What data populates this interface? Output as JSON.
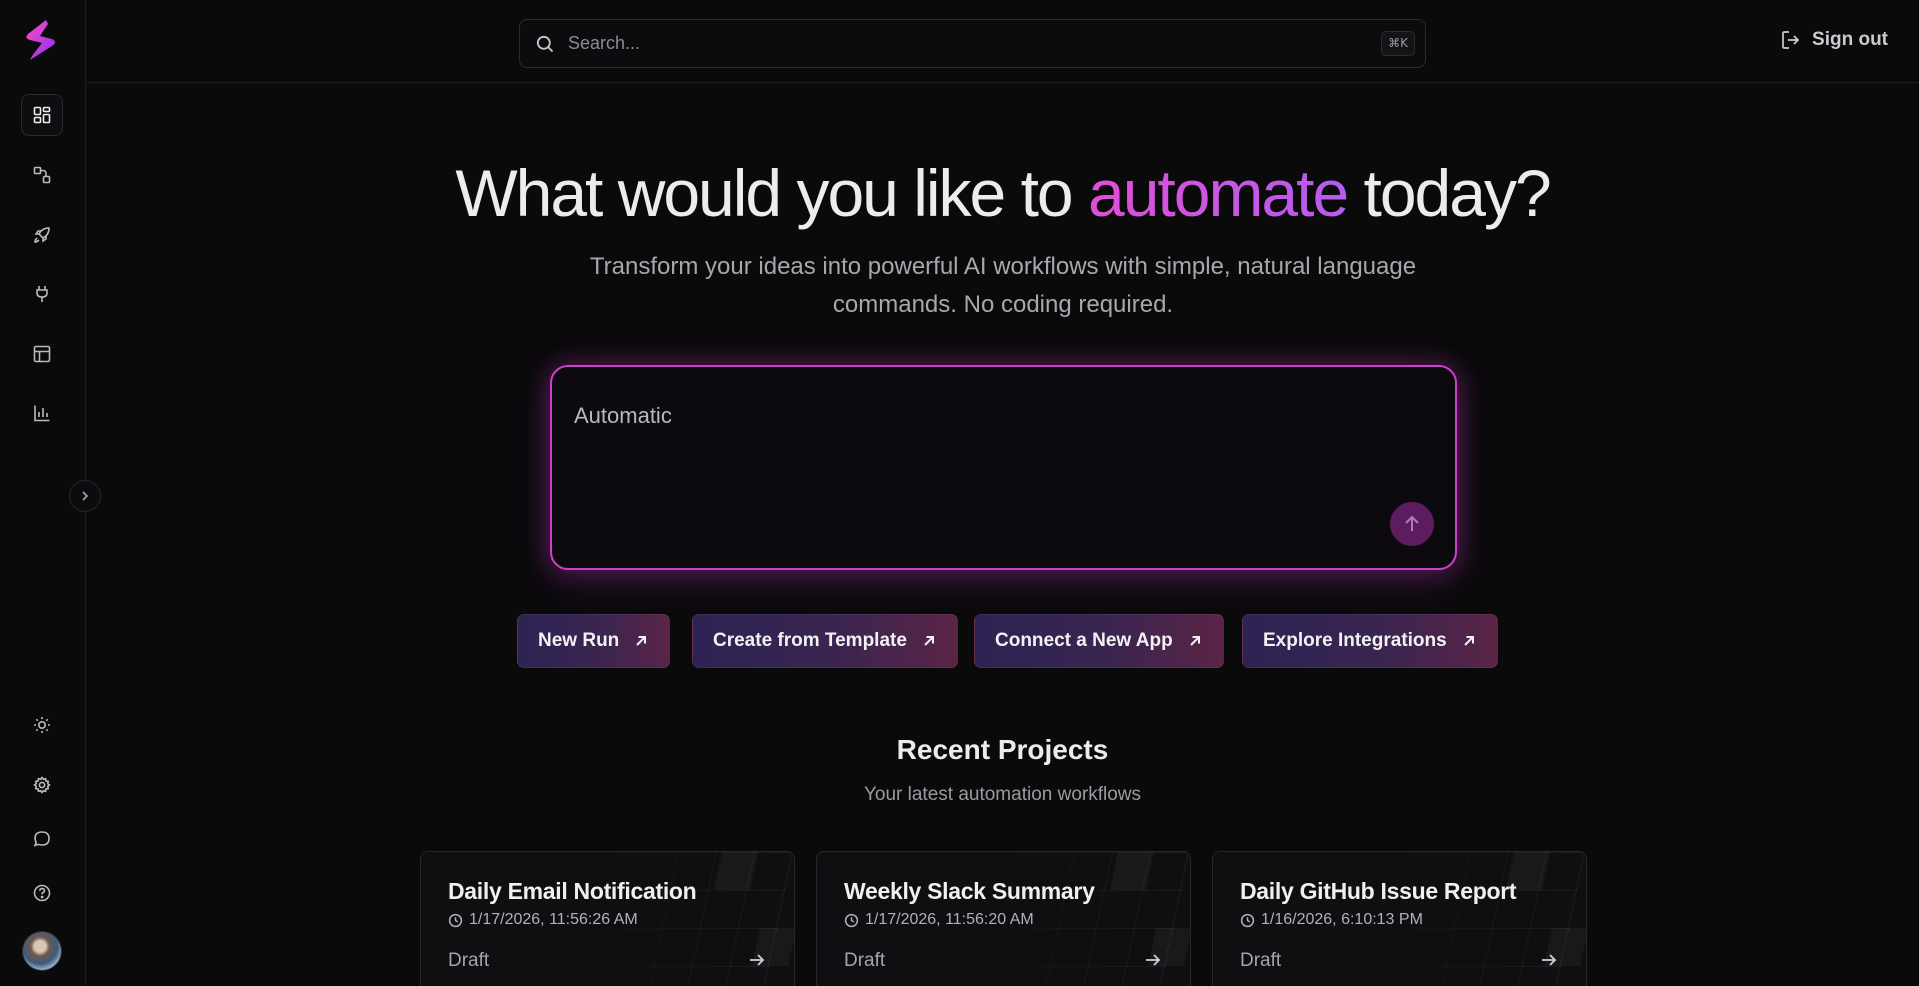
{
  "search": {
    "placeholder": "Search...",
    "shortcut": "⌘K"
  },
  "header": {
    "signout_label": "Sign out"
  },
  "hero": {
    "title_before": "What would you like to ",
    "title_accent": "automate",
    "title_after": " today?",
    "subtitle": "Transform your ideas into powerful AI workflows with simple, natural language commands. No coding required."
  },
  "prompt": {
    "value": "Automatic"
  },
  "actions": [
    {
      "label": "New Run"
    },
    {
      "label": "Create from Template"
    },
    {
      "label": "Connect a New App"
    },
    {
      "label": "Explore Integrations"
    }
  ],
  "recent": {
    "title": "Recent Projects",
    "subtitle": "Your latest automation workflows",
    "projects": [
      {
        "title": "Daily Email Notification",
        "date": "1/17/2026, 11:56:26 AM",
        "status": "Draft"
      },
      {
        "title": "Weekly Slack Summary",
        "date": "1/17/2026, 11:56:20 AM",
        "status": "Draft"
      },
      {
        "title": "Daily GitHub Issue Report",
        "date": "1/16/2026, 6:10:13 PM",
        "status": "Draft"
      }
    ]
  },
  "sidebar": {
    "nav": [
      {
        "icon": "dashboard-icon",
        "active": true
      },
      {
        "icon": "workflow-icon",
        "active": false
      },
      {
        "icon": "rocket-icon",
        "active": false
      },
      {
        "icon": "plug-icon",
        "active": false
      },
      {
        "icon": "template-layout-icon",
        "active": false
      },
      {
        "icon": "bar-chart-icon",
        "active": false
      }
    ],
    "bottom": [
      {
        "icon": "sun-icon"
      },
      {
        "icon": "gear-icon"
      },
      {
        "icon": "chat-bubble-icon"
      },
      {
        "icon": "help-circle-icon"
      }
    ]
  },
  "colors": {
    "accent": "#cf3fcc",
    "accent_gradient_start": "#e04fd6",
    "accent_gradient_end": "#b55cf0",
    "background": "#0a0a0b",
    "send_button": "#5b1d5e"
  }
}
